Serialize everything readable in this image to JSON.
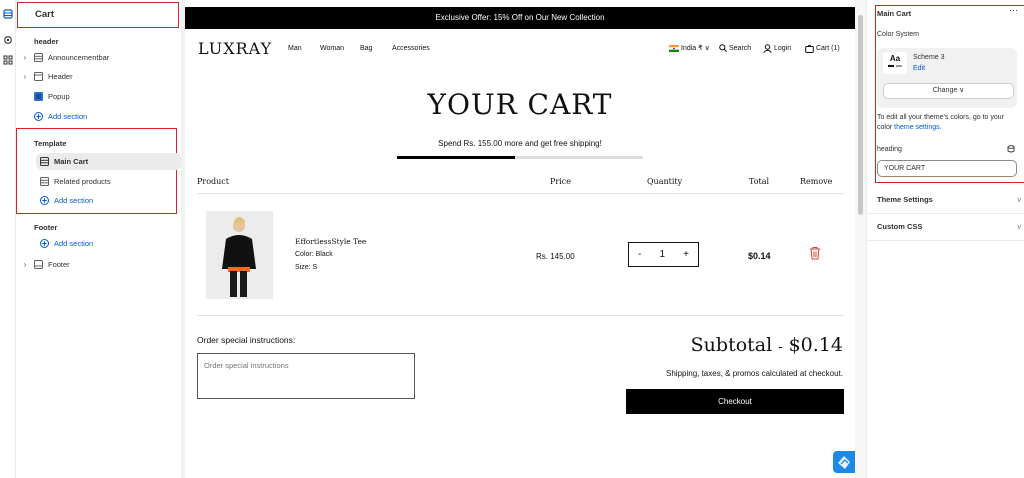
{
  "left_panel": {
    "title": "Cart",
    "header_section": {
      "heading": "header",
      "items": [
        {
          "label": "Announcementbar",
          "icon": "section-icon"
        },
        {
          "label": "Header",
          "icon": "header-icon"
        },
        {
          "label": "Popup",
          "icon": "popup-app-icon"
        }
      ],
      "add_label": "Add section"
    },
    "template_section": {
      "heading": "Template",
      "items": [
        {
          "label": "Main Cart",
          "icon": "section-icon",
          "selected": true
        },
        {
          "label": "Related products",
          "icon": "section-icon"
        }
      ],
      "add_label": "Add section"
    },
    "footer_section": {
      "heading": "Footer",
      "add_label": "Add section",
      "items": [
        {
          "label": "Footer",
          "icon": "footer-icon"
        }
      ]
    }
  },
  "preview": {
    "announcement": "Exclusive Offer: 15% Off on Our New Collection",
    "logo": "LUXRAY",
    "nav": [
      "Man",
      "Woman",
      "Bag",
      "Accessories"
    ],
    "country": "India ₹",
    "search_label": "Search",
    "login_label": "Login",
    "cart_label": "Cart (1)",
    "page_title": "YOUR CART",
    "shipping_message": "Spend Rs. 155.00 more and get free shipping!",
    "shipping_progress": 0.48,
    "table_headers": {
      "product": "Product",
      "price": "Price",
      "quantity": "Quantity",
      "total": "Total",
      "remove": "Remove"
    },
    "item": {
      "name": "EffortlessStyle Tee",
      "color": "Color: Black",
      "size": "Size: S",
      "price": "Rs. 145.00",
      "quantity": "1",
      "minus": "-",
      "plus": "+",
      "total": "$0.14"
    },
    "instructions_label": "Order special instructions:",
    "instructions_placeholder": "Order special instructions",
    "subtotal_label": "Subtotal",
    "subtotal_dash": "-",
    "subtotal_value": "$0.14",
    "tax_note": "Shipping, taxes, & promos calculated at checkout.",
    "checkout_label": "Checkout"
  },
  "right_panel": {
    "title": "Main Cart",
    "more": "···",
    "color_system_label": "Color System",
    "scheme_name": "Scheme 3",
    "scheme_preview": "Aa",
    "edit_label": "Edit",
    "change_label": "Change ∨",
    "help_text_before": "To edit all your theme's colors, go to your color",
    "help_link": "theme settings.",
    "heading_label": "heading",
    "heading_value": "YOUR CART",
    "theme_settings": "Theme Settings",
    "custom_css": "Custom CSS"
  },
  "colors": {
    "accent_link": "#005bd3",
    "highlight_border": "#e01e1e",
    "announcement_bg": "#000000",
    "remove_icon": "#e03c31"
  }
}
